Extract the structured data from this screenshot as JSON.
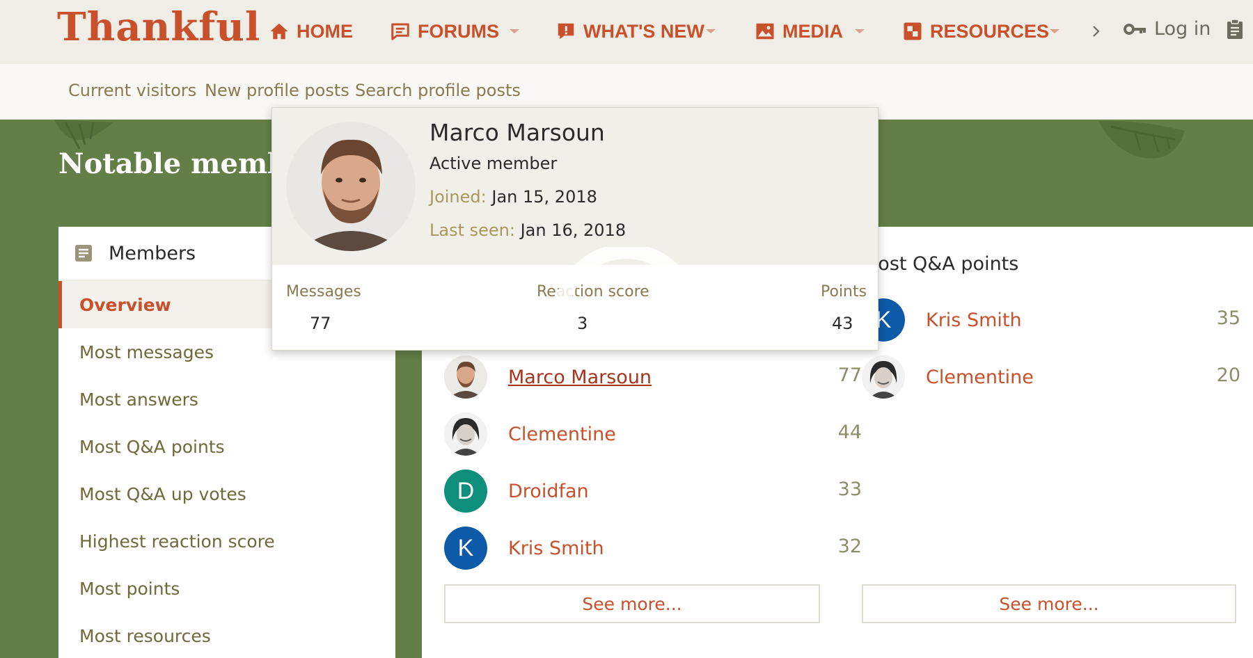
{
  "site": {
    "logo": "Thankful"
  },
  "nav": {
    "items": [
      {
        "label": "HOME",
        "icon": "home-icon"
      },
      {
        "label": "FORUMS",
        "icon": "forum-icon"
      },
      {
        "label": "WHAT'S NEW",
        "icon": "whats-new-icon"
      },
      {
        "label": "MEDIA",
        "icon": "media-icon"
      },
      {
        "label": "RESOURCES",
        "icon": "resources-icon"
      }
    ],
    "login": "Log in"
  },
  "subnav": [
    "Current visitors",
    "New profile posts",
    "Search profile posts"
  ],
  "page": {
    "title": "Notable members"
  },
  "sidebar": {
    "title": "Members",
    "items": [
      {
        "label": "Overview",
        "active": true
      },
      {
        "label": "Most messages"
      },
      {
        "label": "Most answers"
      },
      {
        "label": "Most Q&A points"
      },
      {
        "label": "Most Q&A up votes"
      },
      {
        "label": "Highest reaction score"
      },
      {
        "label": "Most points"
      },
      {
        "label": "Most resources"
      }
    ]
  },
  "lists": {
    "messages": {
      "rows": [
        {
          "name": "Marco Marsoun",
          "value": "77",
          "avatar": "photo-man"
        },
        {
          "name": "Clementine",
          "value": "44",
          "avatar": "photo-woman"
        },
        {
          "name": "Droidfan",
          "value": "33",
          "avatar": "D",
          "color": "#0d8f7c"
        },
        {
          "name": "Kris Smith",
          "value": "32",
          "avatar": "K",
          "color": "#0d5aa8"
        }
      ],
      "see_more": "See more..."
    },
    "qa_points": {
      "title": "Most Q&A points",
      "rows": [
        {
          "name": "Kris Smith",
          "value": "35",
          "avatar": "K",
          "color": "#0d5aa8"
        },
        {
          "name": "Clementine",
          "value": "20",
          "avatar": "photo-woman"
        }
      ],
      "see_more": "See more..."
    }
  },
  "tooltip": {
    "name": "Marco Marsoun",
    "role": "Active member",
    "joined_label": "Joined:",
    "joined": "Jan 15, 2018",
    "last_seen_label": "Last seen:",
    "last_seen": "Jan 16, 2018",
    "stats": [
      {
        "label": "Messages",
        "value": "77"
      },
      {
        "label": "Reaction score",
        "value": "3"
      },
      {
        "label": "Points",
        "value": "43"
      }
    ]
  },
  "colors": {
    "accent": "#c8502a",
    "green": "#647e47",
    "topbar": "#efede6"
  }
}
